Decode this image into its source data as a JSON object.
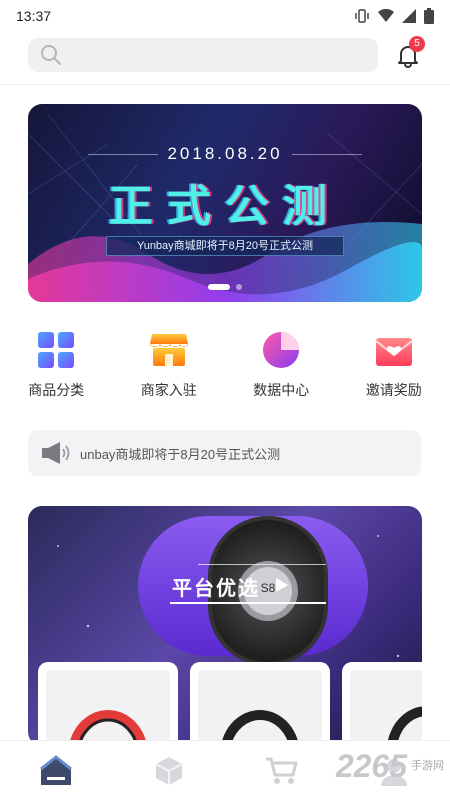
{
  "status_bar": {
    "time": "13:37"
  },
  "header": {
    "notification_count": "5"
  },
  "banner": {
    "date": "2018.08.20",
    "title": "正式公测",
    "subtitle": "Yunbay商城即将于8月20号正式公测"
  },
  "quick_nav": [
    {
      "label": "商品分类",
      "icon": "grid-icon",
      "color": "#6a6cf0"
    },
    {
      "label": "商家入驻",
      "icon": "store-icon",
      "color": "#ff9a1a"
    },
    {
      "label": "数据中心",
      "icon": "pie-chart-icon",
      "color": "#a23bf0"
    },
    {
      "label": "邀请奖励",
      "icon": "envelope-heart-icon",
      "color": "#ff4a66"
    }
  ],
  "notice": {
    "text": "unbay商城即将于8月20号正式公测",
    "icon": "megaphone-icon"
  },
  "promo": {
    "title": "平台优选",
    "speaker_text": "S8"
  },
  "bottom_nav": [
    {
      "icon": "home-icon",
      "active": true
    },
    {
      "icon": "box-icon",
      "active": false
    },
    {
      "icon": "cart-icon",
      "active": false
    },
    {
      "icon": "user-icon",
      "active": false
    }
  ],
  "watermark": {
    "number": "2265",
    "site_line1": "手游网",
    "site_line2": ""
  }
}
